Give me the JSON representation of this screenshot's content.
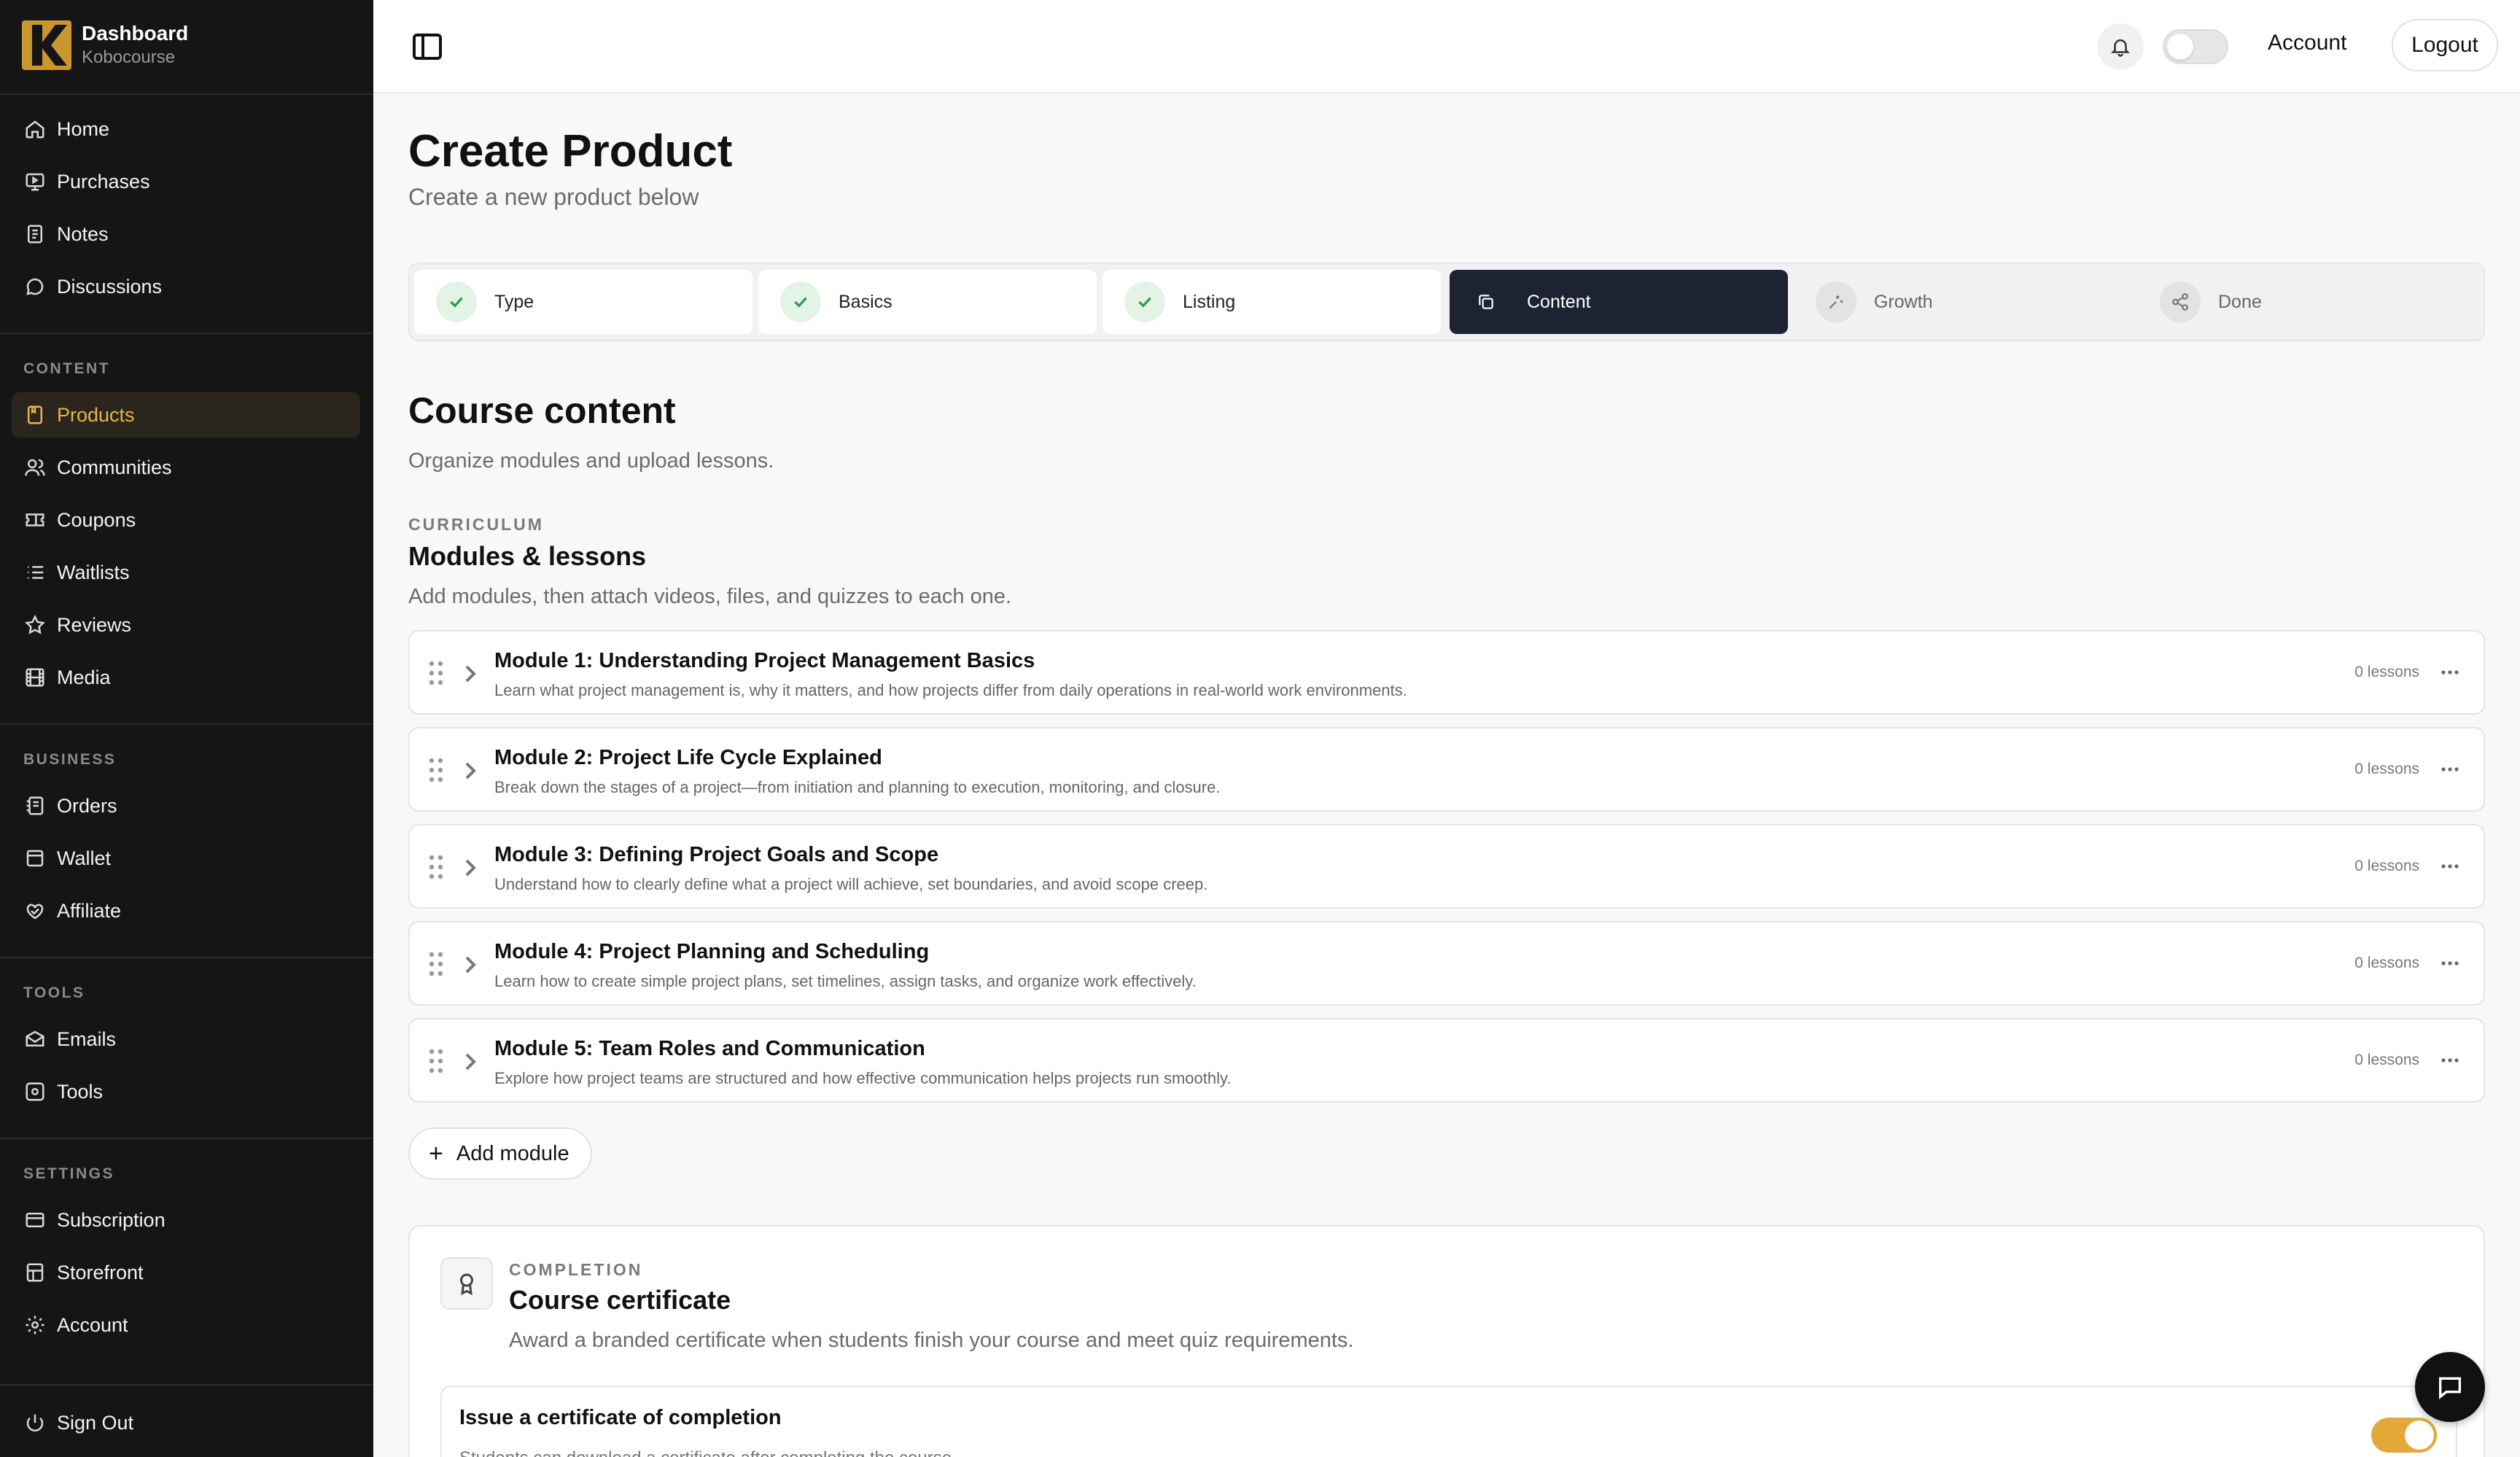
{
  "brand": {
    "title": "Dashboard",
    "subtitle": "Kobocourse",
    "accent": "#e9b44c"
  },
  "sidebar": {
    "main": [
      {
        "label": "Home",
        "icon": "home-icon"
      },
      {
        "label": "Purchases",
        "icon": "monitor-play-icon"
      },
      {
        "label": "Notes",
        "icon": "notes-icon"
      },
      {
        "label": "Discussions",
        "icon": "chat-bubble-icon"
      }
    ],
    "content_label": "CONTENT",
    "content": [
      {
        "label": "Products",
        "icon": "product-icon",
        "active": true
      },
      {
        "label": "Communities",
        "icon": "users-icon"
      },
      {
        "label": "Coupons",
        "icon": "ticket-icon"
      },
      {
        "label": "Waitlists",
        "icon": "list-icon"
      },
      {
        "label": "Reviews",
        "icon": "star-icon"
      },
      {
        "label": "Media",
        "icon": "film-icon"
      }
    ],
    "business_label": "BUSINESS",
    "business": [
      {
        "label": "Orders",
        "icon": "orders-icon"
      },
      {
        "label": "Wallet",
        "icon": "wallet-icon"
      },
      {
        "label": "Affiliate",
        "icon": "handshake-icon"
      }
    ],
    "tools_label": "TOOLS",
    "tools": [
      {
        "label": "Emails",
        "icon": "mail-icon"
      },
      {
        "label": "Tools",
        "icon": "cog-box-icon"
      }
    ],
    "settings_label": "SETTINGS",
    "settings": [
      {
        "label": "Subscription",
        "icon": "credit-card-icon"
      },
      {
        "label": "Storefront",
        "icon": "store-icon"
      },
      {
        "label": "Account",
        "icon": "gear-icon"
      }
    ],
    "signout": "Sign Out"
  },
  "topbar": {
    "account": "Account",
    "logout": "Logout"
  },
  "page": {
    "title": "Create Product",
    "subtitle": "Create a new product below"
  },
  "steps": [
    {
      "label": "Type",
      "state": "done"
    },
    {
      "label": "Basics",
      "state": "done"
    },
    {
      "label": "Listing",
      "state": "done"
    },
    {
      "label": "Content",
      "state": "current"
    },
    {
      "label": "Growth",
      "state": "todo"
    },
    {
      "label": "Done",
      "state": "todo"
    }
  ],
  "course": {
    "title": "Course content",
    "desc": "Organize modules and upload lessons.",
    "curriculum_label": "CURRICULUM",
    "modules_title": "Modules & lessons",
    "modules_desc": "Add modules, then attach videos, files, and quizzes to each one."
  },
  "modules": [
    {
      "title": "Module 1: Understanding Project Management Basics",
      "desc": "Learn what project management is, why it matters, and how projects differ from daily operations in real-world work environments.",
      "lessons": "0 lessons"
    },
    {
      "title": "Module 2: Project Life Cycle Explained",
      "desc": "Break down the stages of a project—from initiation and planning to execution, monitoring, and closure.",
      "lessons": "0 lessons"
    },
    {
      "title": "Module 3: Defining Project Goals and Scope",
      "desc": "Understand how to clearly define what a project will achieve, set boundaries, and avoid scope creep.",
      "lessons": "0 lessons"
    },
    {
      "title": "Module 4: Project Planning and Scheduling",
      "desc": "Learn how to create simple project plans, set timelines, assign tasks, and organize work effectively.",
      "lessons": "0 lessons"
    },
    {
      "title": "Module 5: Team Roles and Communication",
      "desc": "Explore how project teams are structured and how effective communication helps projects run smoothly.",
      "lessons": "0 lessons"
    }
  ],
  "add_module": "Add module",
  "certificate": {
    "label": "COMPLETION",
    "title": "Course certificate",
    "desc": "Award a branded certificate when students finish your course and meet quiz requirements.",
    "issue_title": "Issue a certificate of completion",
    "issue_desc": "Students can download a certificate after completing the course.",
    "enabled": true
  }
}
